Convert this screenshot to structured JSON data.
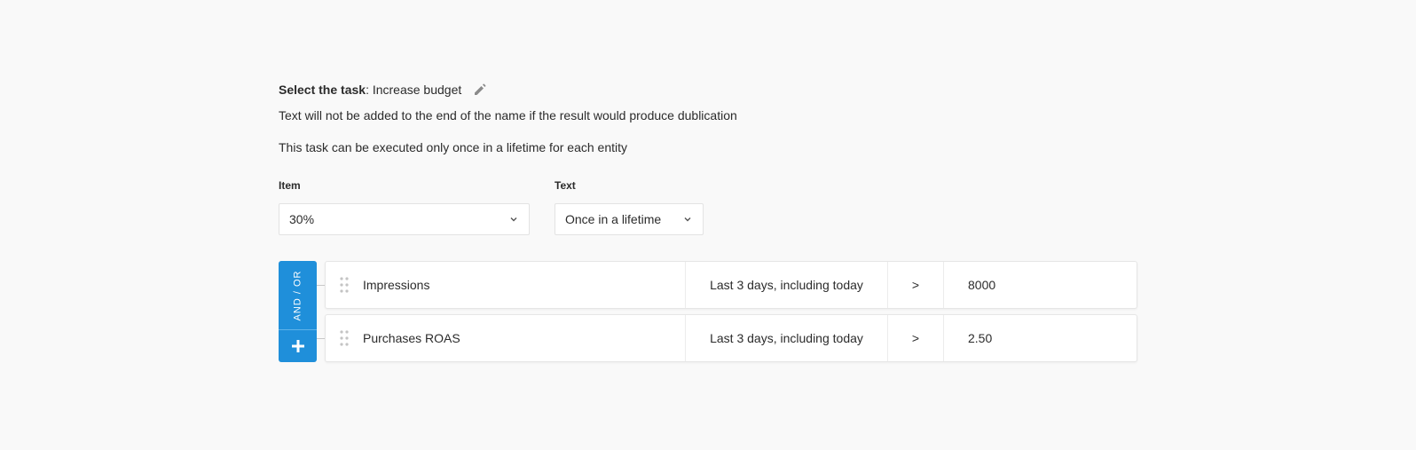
{
  "task": {
    "label": "Select the task",
    "separator": ": ",
    "value": "Increase budget"
  },
  "notes": [
    "Text will not be added to the end of the name if the result would produce dublication",
    "This task can be executed only once in a lifetime for each entity"
  ],
  "fields": {
    "item": {
      "label": "Item",
      "value": "30%"
    },
    "text": {
      "label": "Text",
      "value": "Once in a lifetime"
    }
  },
  "conditions": {
    "group_label": "AND / OR",
    "rows": [
      {
        "metric": "Impressions",
        "period": "Last 3 days, including today",
        "operator": ">",
        "value": "8000"
      },
      {
        "metric": "Purchases ROAS",
        "period": "Last 3 days, including today",
        "operator": ">",
        "value": "2.50"
      }
    ]
  },
  "icons": {
    "edit": "pencil-icon",
    "chevron": "chevron-down-icon",
    "drag": "drag-handle-icon",
    "add": "plus-icon"
  },
  "colors": {
    "accent": "#1f8fda",
    "background": "#f9f9f9",
    "text": "#2b2b2b"
  }
}
